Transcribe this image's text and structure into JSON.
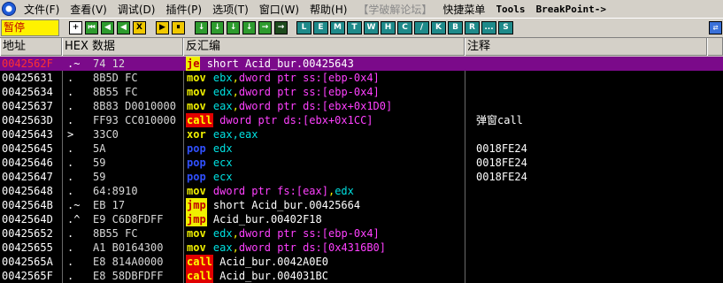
{
  "menu": [
    {
      "label": "文件(F)"
    },
    {
      "label": "查看(V)"
    },
    {
      "label": "调试(D)"
    },
    {
      "label": "插件(P)"
    },
    {
      "label": "选项(T)"
    },
    {
      "label": "窗口(W)"
    },
    {
      "label": "帮助(H)"
    },
    {
      "label": "【学破解论坛】",
      "disabled": true
    },
    {
      "label": "快捷菜单"
    },
    {
      "label": "Tools"
    },
    {
      "label": "BreakPoint->"
    }
  ],
  "toolbar": {
    "status": "暂停",
    "buttons": [
      "+",
      "⏮",
      "◀",
      "◀",
      "X",
      "▶",
      "⏸",
      "↓",
      "↓",
      "↓",
      "↓",
      "→",
      "→",
      "L",
      "E",
      "M",
      "T",
      "W",
      "H",
      "C",
      "/",
      "K",
      "B",
      "R",
      "...",
      "S"
    ],
    "end_icon": "⇄"
  },
  "columns": {
    "address": "地址",
    "hex": "HEX 数据",
    "disasm": "反汇编",
    "comment": "注释"
  },
  "rows": [
    {
      "addr": "0042562F",
      "mark": ".~",
      "hex": "74 12",
      "mnemonic": "je",
      "operand": "short Acid_bur.00425643",
      "comment": "",
      "selected": true
    },
    {
      "addr": "00425631",
      "mark": ".",
      "hex": "8B5D FC",
      "mnemonic": "mov",
      "operand": "ebx,dword ptr ss:[ebp-0x4]",
      "comment": ""
    },
    {
      "addr": "00425634",
      "mark": ".",
      "hex": "8B55 FC",
      "mnemonic": "mov",
      "operand": "edx,dword ptr ss:[ebp-0x4]",
      "comment": ""
    },
    {
      "addr": "00425637",
      "mark": ".",
      "hex": "8B83 D0010000",
      "mnemonic": "mov",
      "operand": "eax,dword ptr ds:[ebx+0x1D0]",
      "comment": ""
    },
    {
      "addr": "0042563D",
      "mark": ".",
      "hex": "FF93 CC010000",
      "mnemonic": "call",
      "operand": "dword ptr ds:[ebx+0x1CC]",
      "comment": "弹窗call"
    },
    {
      "addr": "00425643",
      "mark": ">",
      "hex": "33C0",
      "mnemonic": "xor",
      "operand": "eax,eax",
      "comment": ""
    },
    {
      "addr": "00425645",
      "mark": ".",
      "hex": "5A",
      "mnemonic": "pop",
      "operand": "edx",
      "comment": "0018FE24"
    },
    {
      "addr": "00425646",
      "mark": ".",
      "hex": "59",
      "mnemonic": "pop",
      "operand": "ecx",
      "comment": "0018FE24"
    },
    {
      "addr": "00425647",
      "mark": ".",
      "hex": "59",
      "mnemonic": "pop",
      "operand": "ecx",
      "comment": "0018FE24"
    },
    {
      "addr": "00425648",
      "mark": ".",
      "hex": "64:8910",
      "mnemonic": "mov",
      "operand": "dword ptr fs:[eax],edx",
      "comment": ""
    },
    {
      "addr": "0042564B",
      "mark": ".~",
      "hex": "EB 17",
      "mnemonic": "jmp",
      "operand": "short Acid_bur.00425664",
      "comment": ""
    },
    {
      "addr": "0042564D",
      "mark": ".^",
      "hex": "E9 C6D8FDFF",
      "mnemonic": "jmp",
      "operand": "Acid_bur.00402F18",
      "comment": ""
    },
    {
      "addr": "00425652",
      "mark": ".",
      "hex": "8B55 FC",
      "mnemonic": "mov",
      "operand": "edx,dword ptr ss:[ebp-0x4]",
      "comment": ""
    },
    {
      "addr": "00425655",
      "mark": ".",
      "hex": "A1 B0164300",
      "mnemonic": "mov",
      "operand": "eax,dword ptr ds:[0x4316B0]",
      "comment": ""
    },
    {
      "addr": "0042565A",
      "mark": ".",
      "hex": "E8 814A0000",
      "mnemonic": "call",
      "operand": "Acid_bur.0042A0E0",
      "comment": ""
    },
    {
      "addr": "0042565F",
      "mark": ".",
      "hex": "E8 58DBFDFF",
      "mnemonic": "call",
      "operand": "Acid_bur.004031BC",
      "comment": ""
    }
  ]
}
